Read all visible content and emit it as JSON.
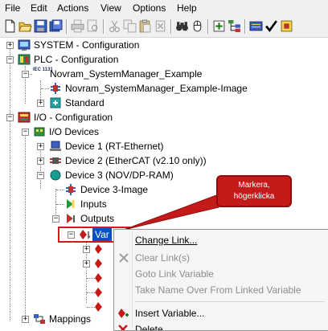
{
  "menu": {
    "file": "File",
    "edit": "Edit",
    "actions": "Actions",
    "view": "View",
    "options": "Options",
    "help": "Help"
  },
  "toolbar_icons": [
    "new-icon",
    "open-icon",
    "save-icon",
    "save-as-icon",
    "print-icon",
    "print-preview-icon",
    "cut-icon",
    "copy-icon",
    "paste-icon",
    "delete-icon",
    "find-icon",
    "mouse-icon",
    "add-icon",
    "tree-icon",
    "activate-icon",
    "check-icon",
    "build-icon"
  ],
  "tree": {
    "system": "SYSTEM - Configuration",
    "plc": "PLC - Configuration",
    "plc_project": "Novram_SystemManager_Example",
    "plc_image": "Novram_SystemManager_Example-Image",
    "plc_standard": "Standard",
    "io": "I/O - Configuration",
    "io_devices": "I/O Devices",
    "device1": "Device 1 (RT-Ethernet)",
    "device2": "Device 2 (EtherCAT (v2.10 only))",
    "device3": "Device 3 (NOV/DP-RAM)",
    "device3_image": "Device 3-Image",
    "inputs": "Inputs",
    "outputs": "Outputs",
    "var": "Var",
    "mappings": "Mappings",
    "iec_badge": "IEC 1131"
  },
  "callout": {
    "line1": "Markera,",
    "line2": "högerklicka"
  },
  "context_menu": {
    "change_link": "Change Link...",
    "clear_links": "Clear Link(s)",
    "goto_link": "Goto Link Variable",
    "take_name": "Take Name Over From Linked Variable",
    "insert_variable": "Insert Variable...",
    "delete": "Delete"
  },
  "colors": {
    "selection": "#0a50c8",
    "callout": "#c51a1a",
    "highlight_box": "#d11a1a"
  }
}
